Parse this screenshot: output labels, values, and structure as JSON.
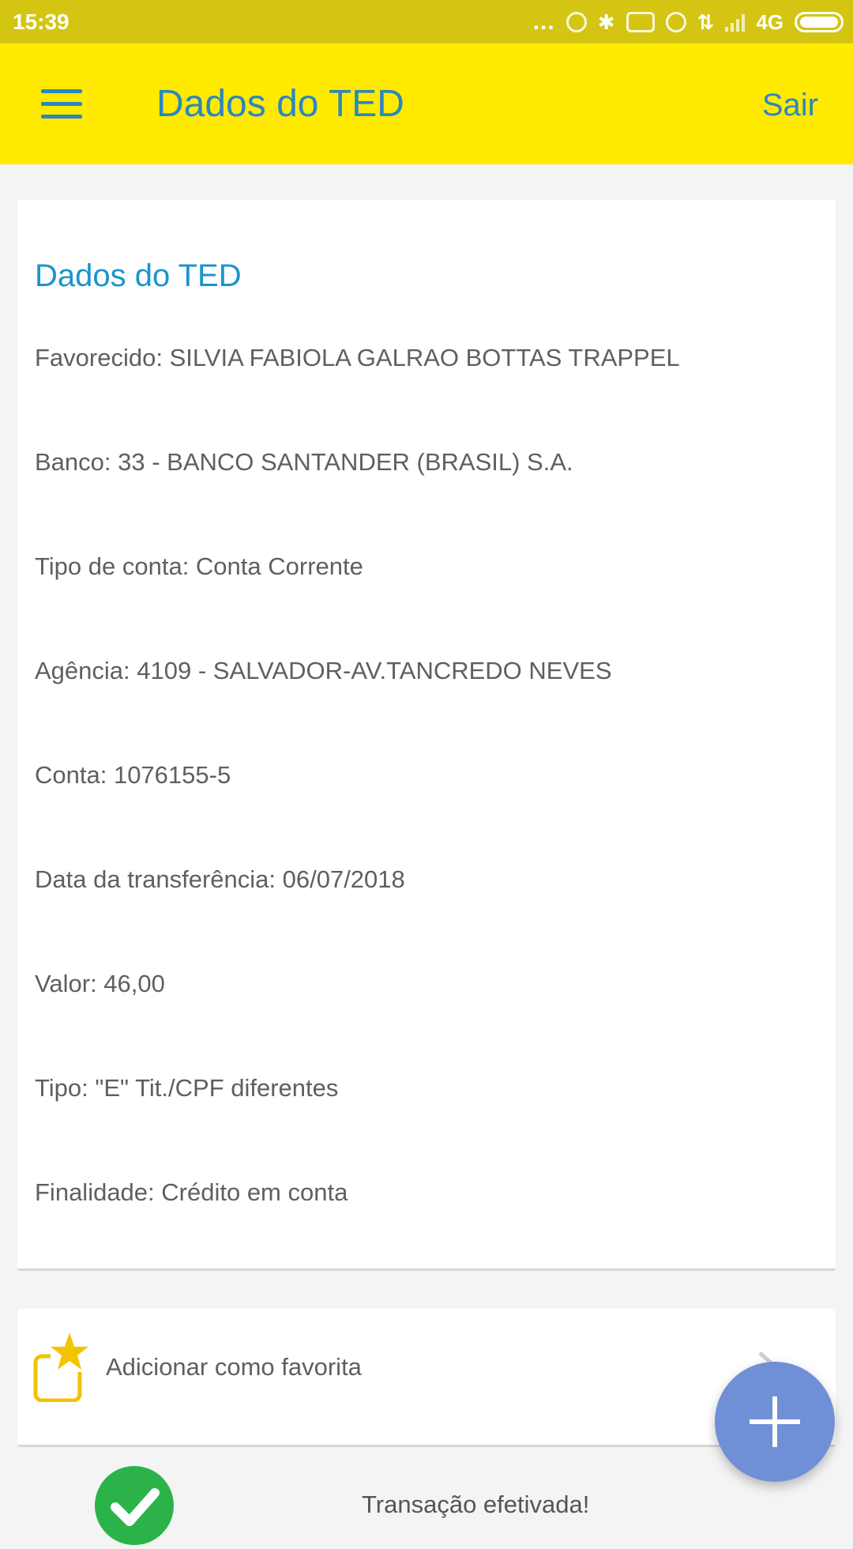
{
  "status_bar": {
    "time": "15:39",
    "dots": "...",
    "network": "4G"
  },
  "toolbar": {
    "title": "Dados do TED",
    "logout_label": "Sair",
    "color": "#ffea00",
    "accent": "#2a87c0"
  },
  "details": {
    "title": "Dados do TED",
    "fields": [
      "Favorecido: SILVIA FABIOLA GALRAO BOTTAS TRAPPEL",
      "Banco: 33 - BANCO SANTANDER (BRASIL) S.A.",
      "Tipo de conta: Conta Corrente",
      "Agência: 4109 - SALVADOR-AV.TANCREDO NEVES",
      "Conta: 1076155-5",
      "Data da transferência: 06/07/2018",
      "Valor: 46,00",
      "Tipo: \"E\" Tit./CPF diferentes",
      "Finalidade: Crédito em conta"
    ]
  },
  "favorite": {
    "label": "Adicionar como favorita",
    "icon": "star-favorite-icon",
    "chevron_icon": "chevron-right-icon"
  },
  "result": {
    "message": "Transação efetivada!",
    "icon": "check-circle-icon",
    "color": "#2bb34a"
  },
  "fab": {
    "icon": "plus-icon",
    "color": "#6f8fd6"
  }
}
